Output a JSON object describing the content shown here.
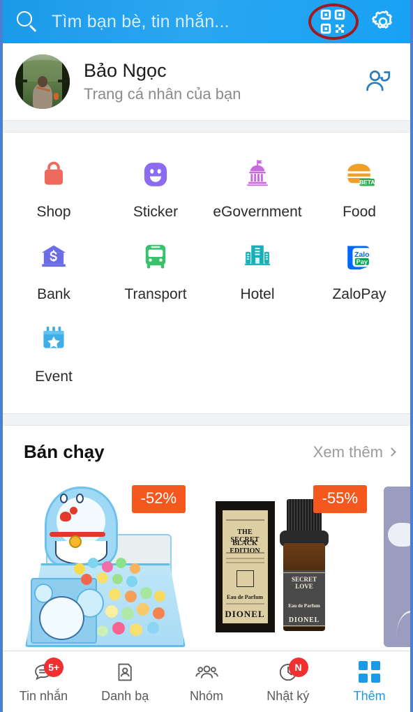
{
  "header": {
    "search_icon": "search-icon",
    "search_placeholder": "Tìm bạn bè, tin nhắn...",
    "qr_icon": "qr-code-icon",
    "settings_icon": "gear-icon",
    "annotation_color": "#9e1b1f",
    "background_color": "#1b9ae8"
  },
  "profile": {
    "name": "Bảo Ngọc",
    "subtitle": "Trang cá nhân của bạn",
    "avatar_icon": "avatar",
    "action_icon": "switch-account-icon"
  },
  "apps": [
    {
      "label": "Shop",
      "icon": "shopping-bag-icon",
      "color": "#ef6a5e"
    },
    {
      "label": "Sticker",
      "icon": "smiley-face-icon",
      "color": "#8b6cf0"
    },
    {
      "label": "eGovernment",
      "icon": "government-building-icon",
      "color": "#c86ae0"
    },
    {
      "label": "Food",
      "icon": "burger-icon",
      "color": "#f0a02a",
      "badge": "BETA",
      "badge_color": "#34a853"
    },
    {
      "label": "Bank",
      "icon": "bank-icon",
      "color": "#6a6ce8"
    },
    {
      "label": "Transport",
      "icon": "bus-icon",
      "color": "#39c16c"
    },
    {
      "label": "Hotel",
      "icon": "hotel-building-icon",
      "color": "#17b0ba"
    },
    {
      "label": "ZaloPay",
      "icon": "zalopay-logo-icon",
      "color": "#0068ff",
      "logo_text_1": "Zalo",
      "logo_text_2": "Pay"
    },
    {
      "label": "Event",
      "icon": "calendar-star-icon",
      "color": "#3eaeea"
    }
  ],
  "section": {
    "title": "Bán chạy",
    "more_label": "Xem thêm",
    "more_icon": "chevron-right-icon"
  },
  "products": [
    {
      "name": "doraemon-ball-pit",
      "discount": "-52%",
      "discount_color": "#f4581f"
    },
    {
      "name": "dionel-secret-love-perfume",
      "discount": "-55%",
      "discount_color": "#f4581f",
      "box_line_1": "THE SECRET",
      "box_line_2": "BLACK EDITION",
      "box_line_3": "Eau de Parfum",
      "box_brand": "DIONEL",
      "bottle_line_1": "SECRET LOVE",
      "bottle_line_2": "Eau de Parfum",
      "bottle_brand": "DIONEL"
    },
    {
      "name": "earphone-product",
      "discount": ""
    }
  ],
  "bottom_nav": [
    {
      "label": "Tin nhắn",
      "icon": "chat-bubble-icon",
      "badge": "5+",
      "active": false
    },
    {
      "label": "Danh bạ",
      "icon": "contact-card-icon",
      "badge": "",
      "active": false
    },
    {
      "label": "Nhóm",
      "icon": "group-people-icon",
      "badge": "",
      "active": false
    },
    {
      "label": "Nhật ký",
      "icon": "clock-icon",
      "badge": "N",
      "active": false
    },
    {
      "label": "Thêm",
      "icon": "grid-icon",
      "badge": "",
      "active": true
    }
  ],
  "colors": {
    "accent": "#1b9ae8",
    "badge_red": "#f03030",
    "frame_blue": "#4a7fd4"
  }
}
